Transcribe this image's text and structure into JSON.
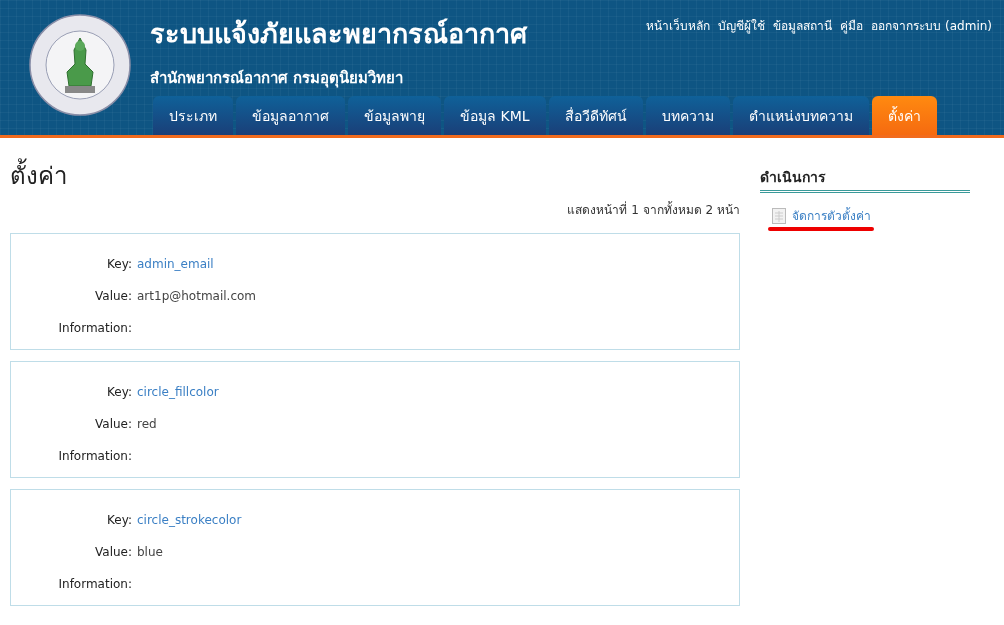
{
  "header": {
    "title": "ระบบแจ้งภัยและพยากรณ์อากาศ",
    "subtitle": "สำนักพยากรณ์อากาศ กรมอุตุนิยมวิทยา",
    "top_links": [
      "หน้าเว็บหลัก",
      "บัญชีผู้ใช้",
      "ข้อมูลสถานี",
      "คู่มือ",
      "ออกจากระบบ (admin)"
    ],
    "tabs": [
      {
        "label": "ประเภท",
        "selected": false
      },
      {
        "label": "ข้อมูลอากาศ",
        "selected": false
      },
      {
        "label": "ข้อมูลพายุ",
        "selected": false
      },
      {
        "label": "ข้อมูล KML",
        "selected": false
      },
      {
        "label": "สื่อวีดีทัศน์",
        "selected": false
      },
      {
        "label": "บทความ",
        "selected": false
      },
      {
        "label": "ตำแหน่งบทความ",
        "selected": false
      },
      {
        "label": "ตั้งค่า",
        "selected": true
      }
    ]
  },
  "page_title": "ตั้งค่า",
  "pager": "แสดงหน้าที่ 1 จากทั้งหมด 2 หน้า",
  "records": [
    {
      "key_label": "Key:",
      "key": "admin_email",
      "value_label": "Value:",
      "value": "art1p@hotmail.com",
      "info_label": "Information:"
    },
    {
      "key_label": "Key:",
      "key": "circle_fillcolor",
      "value_label": "Value:",
      "value": "red",
      "info_label": "Information:"
    },
    {
      "key_label": "Key:",
      "key": "circle_strokecolor",
      "value_label": "Value:",
      "value": "blue",
      "info_label": "Information:"
    }
  ],
  "sidebar": {
    "heading": "ดำเนินการ",
    "links": [
      {
        "label": "จัดการตัวตั้งค่า",
        "highlighted": true
      }
    ]
  }
}
